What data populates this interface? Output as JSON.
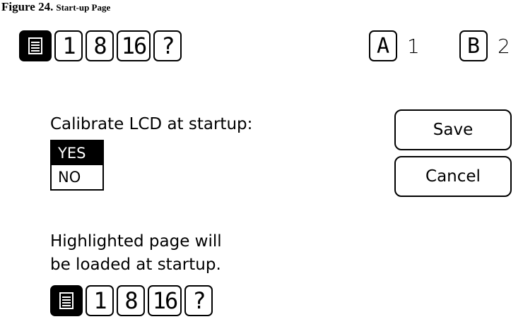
{
  "caption": {
    "figure": "Figure 24.",
    "title": "Start-up Page"
  },
  "top_tabs": [
    {
      "kind": "icon",
      "icon": "page-icon",
      "selected": true
    },
    {
      "label": "1"
    },
    {
      "label": "8"
    },
    {
      "label": "16"
    },
    {
      "label": "?"
    }
  ],
  "drives": [
    {
      "letter": "A",
      "number": "1"
    },
    {
      "letter": "B",
      "number": "2"
    }
  ],
  "calibrate": {
    "label": "Calibrate LCD at startup:",
    "options": [
      "YES",
      "NO"
    ],
    "selected": "YES"
  },
  "buttons": {
    "save": "Save",
    "cancel": "Cancel"
  },
  "startup_page": {
    "line1": "Highlighted page will",
    "line2": "be loaded at startup."
  },
  "bottom_tabs": [
    {
      "kind": "icon",
      "icon": "page-icon",
      "selected": true
    },
    {
      "label": "1"
    },
    {
      "label": "8"
    },
    {
      "label": "16"
    },
    {
      "label": "?"
    }
  ]
}
